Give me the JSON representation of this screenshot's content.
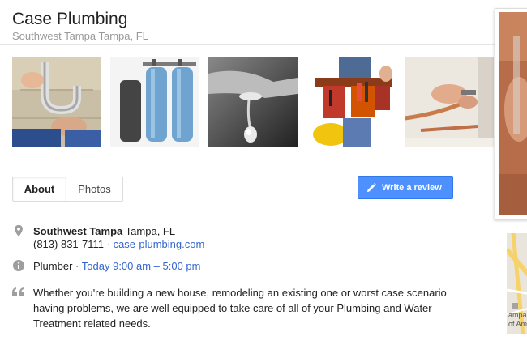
{
  "business": {
    "name": "Case Plumbing",
    "location": "Southwest Tampa Tampa, FL"
  },
  "photos": [
    {
      "name": "photo-pipe-repair"
    },
    {
      "name": "photo-water-tanks"
    },
    {
      "name": "photo-faucet-drip"
    },
    {
      "name": "photo-tool-belt"
    },
    {
      "name": "photo-copper-pipes"
    }
  ],
  "tabs": {
    "about": "About",
    "photos": "Photos"
  },
  "review_button": "Write a review",
  "address": {
    "area": "Southwest Tampa",
    "city": "Tampa, FL"
  },
  "phone": "(813) 831-7111",
  "separator": "·",
  "website": "case-plumbing.com",
  "category": "Plumber",
  "hours": "Today 9:00 am – 5:00 pm",
  "description": "Whether you're building a new house, remodeling an existing one or worst case scenario having problems, we are well equipped to take care of all of your Plumbing and Water Treatment related needs.",
  "map": {
    "label_line1": "ampa",
    "label_line2": "of Am"
  },
  "colors": {
    "accent": "#4d90fe",
    "link": "#3366cc",
    "muted": "#999999"
  }
}
